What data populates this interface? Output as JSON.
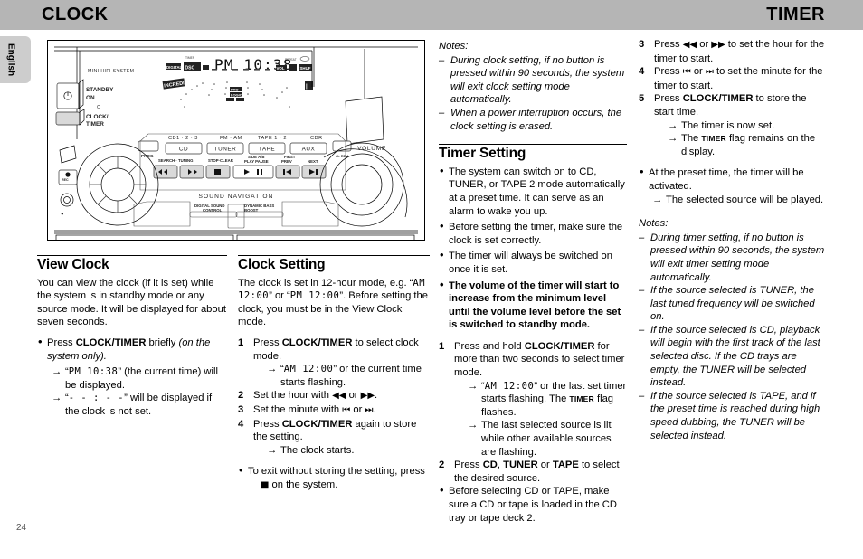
{
  "header": {
    "left_title": "CLOCK",
    "right_title": "TIMER"
  },
  "language_tab": "English",
  "page_number": "24",
  "illustration": {
    "brand_label": "MINI HIFI SYSTEM",
    "standby_label_line1": "STANDBY",
    "standby_label_line2": "ON",
    "clock_timer_label_line1": "CLOCK/",
    "clock_timer_label_line2": "TIMER",
    "display_time": "PM 10:38",
    "source_row": [
      "CD1 · 2 · 3",
      "FM · AM",
      "TAPE 1 · 2",
      "CDR"
    ],
    "source_buttons": [
      "CD",
      "TUNER",
      "TAPE",
      "AUX"
    ],
    "prog_label": "PROG",
    "jog_label": "JL REV",
    "volume_label": "VOLUME",
    "transport_labels": [
      "SEARCH · TUNING",
      "STOP·CLEAR",
      "SIDE A/B",
      "PLAY · PAUSE",
      "PREV",
      "NEXT"
    ],
    "sound_navigation_label": "SOUND NAVIGATION",
    "dsc_label_line1": "DIGITAL SOUND",
    "dsc_label_line2": "CONTROL",
    "dbb_label_line1": "DYNAMIC BASS",
    "dbb_label_line2": "BOOST",
    "headphone_icon": "headphone-icon"
  },
  "view_clock": {
    "heading": "View Clock",
    "intro": "You can view the clock (if it is set) while the system is in standby mode or any source mode. It will be displayed for about seven seconds.",
    "bullet_pre": "Press ",
    "bullet_bold": "CLOCK/TIMER",
    "bullet_post": " briefly ",
    "bullet_italic": "(on the system only).",
    "result1_open": "“",
    "result1_lcd": "PM  10:38",
    "result1_close": "” (the current time) will be displayed.",
    "result2_open": "“",
    "result2_lcd": "- - : - -",
    "result2_close": "” will be displayed if the clock is not set."
  },
  "clock_setting": {
    "heading": "Clock Setting",
    "intro_a": "The clock is set in 12-hour mode, e.g. “",
    "intro_lcd1": "AM  12:00",
    "intro_b": "” or “",
    "intro_lcd2": "PM  12:00",
    "intro_c": "”. Before setting the clock, you must be in the View Clock mode.",
    "steps": [
      {
        "num": "1",
        "pre": "Press ",
        "bold": "CLOCK/TIMER",
        "post": " to select clock mode.",
        "result_open": "“",
        "result_lcd": "AM  12:00",
        "result_close": "” or the current time starts flashing."
      },
      {
        "num": "2",
        "pre": "Set the hour with ",
        "glyph1": "◀◀",
        "mid": " or ",
        "glyph2": "▶▶",
        "post": "."
      },
      {
        "num": "3",
        "pre": "Set the minute with ",
        "glyph1": "⏮",
        "mid": " or ",
        "glyph2": "⏭",
        "post": "."
      },
      {
        "num": "4",
        "pre": "Press ",
        "bold": "CLOCK/TIMER",
        "post": " again to store the setting.",
        "result_close": "The clock starts."
      }
    ],
    "exit_bullet_pre": "To exit without storing the setting, press ",
    "exit_bullet_glyph": "■",
    "exit_bullet_post": " on the system."
  },
  "clock_notes": {
    "label": "Notes:",
    "items": [
      "During clock setting,  if no button is pressed within 90 seconds, the system will exit clock setting mode automatically.",
      "When a power interruption occurs, the clock setting is erased."
    ]
  },
  "timer_setting": {
    "heading": "Timer Setting",
    "bullets": [
      "The system can switch on to CD, TUNER, or TAPE 2 mode automatically at a preset time. It can serve as an alarm to wake you up.",
      "Before setting the timer, make sure the clock is set correctly.",
      "The timer will always be switched on once it is set."
    ],
    "bold_bullet": "The volume of the timer will start to increase from the minimum level until the volume level before the set is switched to standby mode.",
    "steps": [
      {
        "num": "1",
        "pre": "Press and hold ",
        "bold": "CLOCK/TIMER",
        "post": " for more than two seconds to select timer mode.",
        "result1_open": "“",
        "result1_lcd": "AM  12:00",
        "result1_mid": "” or the last set timer starts flashing. The ",
        "result1_flag": "TIMER",
        "result1_close": " flag flashes.",
        "result2": "The last selected source is lit while other available sources are flashing."
      },
      {
        "num": "2",
        "pre": "Press ",
        "bold1": "CD",
        "sep1": ", ",
        "bold2": "TUNER",
        "sep2": " or ",
        "bold3": "TAPE",
        "post": "  to select the desired source."
      },
      {
        "num": "3",
        "pre": "Press ",
        "glyph1": "◀◀",
        "mid": " or ",
        "glyph2": "▶▶",
        "post": " to set the hour for the timer to start."
      },
      {
        "num": "4",
        "pre": "Press ",
        "glyph1": "⏮",
        "mid": " or ",
        "glyph2": "⏭",
        "post": " to set the minute for the timer to start."
      },
      {
        "num": "5",
        "pre": "Press ",
        "bold": "CLOCK/TIMER",
        "post": " to store the start time.",
        "result1": "The timer is now set.",
        "result2_pre": "The ",
        "result2_flag": "TIMER",
        "result2_post": " flag remains on the display."
      }
    ],
    "source_note": "Before selecting CD or TAPE, make sure a CD or tape is loaded in the CD tray or tape deck 2.",
    "preset_bullet": "At the preset time, the timer will be activated.",
    "preset_result": "The selected source will be played."
  },
  "timer_notes": {
    "label": "Notes:",
    "items": [
      "During timer setting, if no button is pressed within 90 seconds, the system will exit timer setting mode automatically.",
      "If the source selected is TUNER, the last tuned frequency will be switched on.",
      "If the source selected is CD, playback will begin with the first track of the last selected disc. If the CD trays are empty, the TUNER will be selected instead.",
      "If the source selected is TAPE, and if the preset time is reached during high speed dubbing, the TUNER will be selected instead."
    ]
  },
  "colors": {
    "header_bg": "#b5b5b5",
    "tab_bg": "#cdcdcd",
    "text": "#000000"
  }
}
